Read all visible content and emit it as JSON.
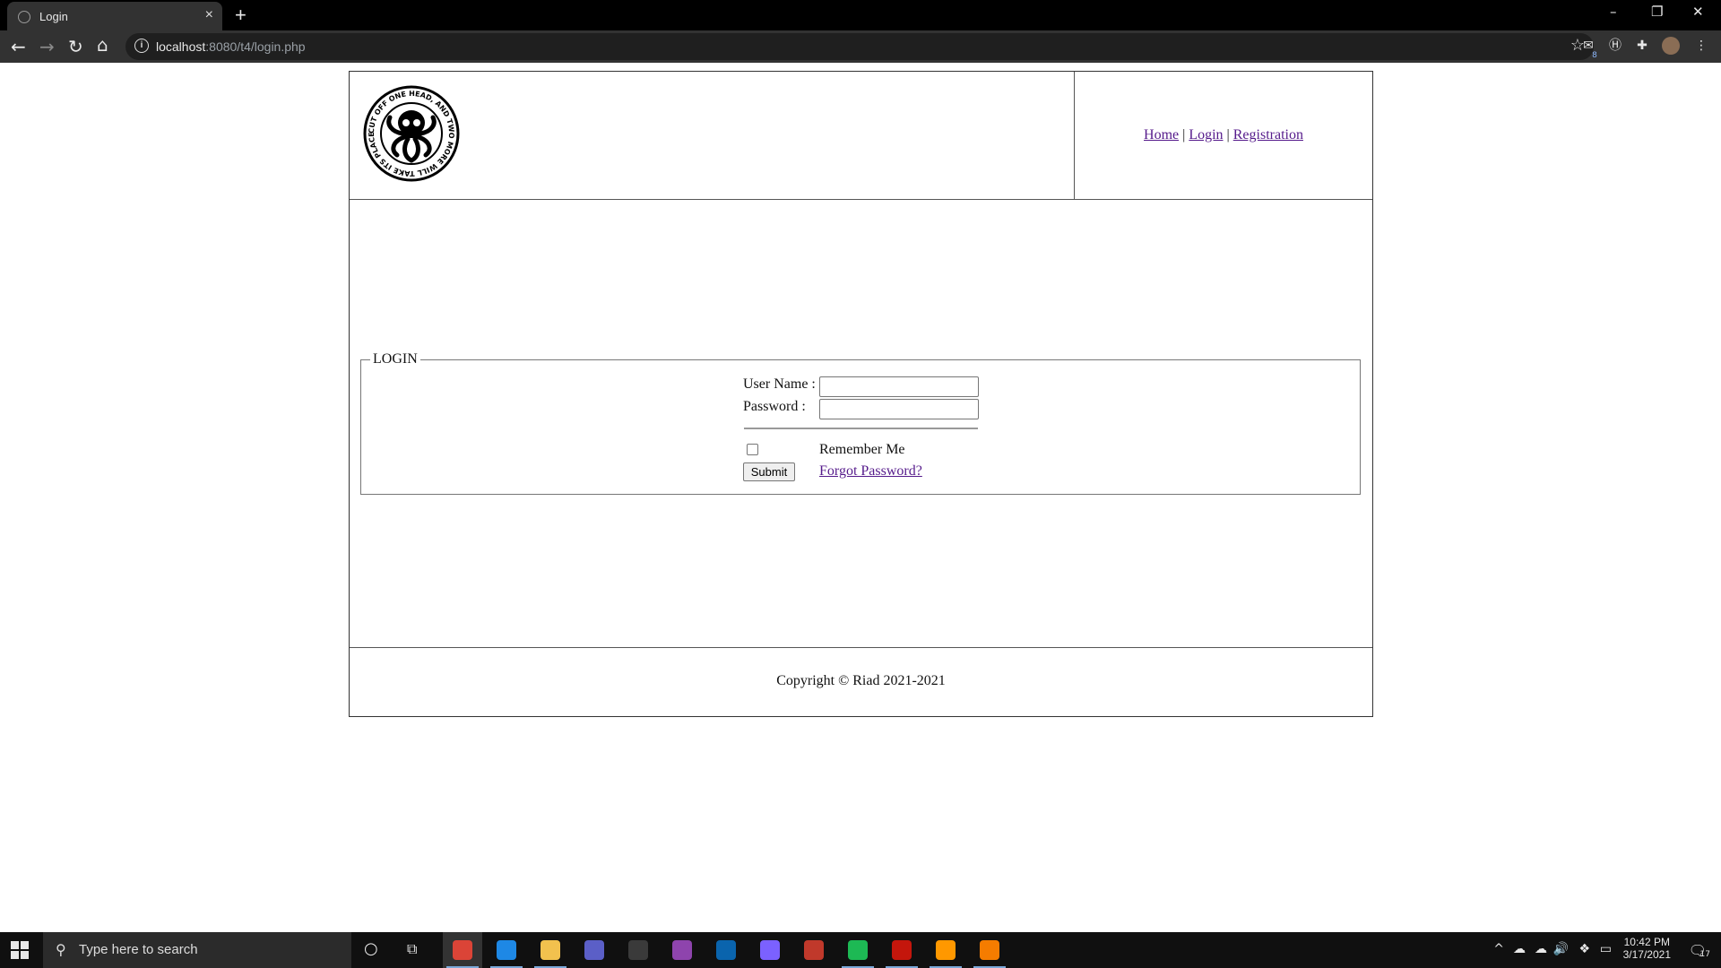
{
  "browser": {
    "tab_title": "Login",
    "tab_close": "×",
    "new_tab": "+",
    "url_host": "localhost",
    "url_rest": ":8080/t4/login.php",
    "info_glyph": "i",
    "window_controls": {
      "minimize": "–",
      "restore": "❐",
      "close": "✕"
    },
    "extension_badge": "8"
  },
  "header": {
    "nav": {
      "home": "Home",
      "sep": " | ",
      "login": "Login",
      "registration": "Registration"
    },
    "logo_text": "CUT OFF ONE HEAD, AND TWO MORE WILL TAKE ITS PLACE"
  },
  "login": {
    "legend": "LOGIN",
    "username_label": "User Name :",
    "password_label": "Password :",
    "username_value": "",
    "password_value": "",
    "remember_label": "Remember Me",
    "remember_checked": false,
    "submit_label": "Submit",
    "forgot_label": "Forgot Password?"
  },
  "footer": {
    "copyright": "Copyright © Riad 2021-2021"
  },
  "taskbar": {
    "search_placeholder": "Type here to search",
    "time": "10:42 PM",
    "date": "3/17/2021",
    "notification_count": "17",
    "apps": [
      {
        "name": "chrome",
        "color": "#db4437",
        "active": true
      },
      {
        "name": "vscode",
        "color": "#1e88e5",
        "active": false
      },
      {
        "name": "file-explorer",
        "color": "#f2c14e",
        "active": false
      },
      {
        "name": "teams",
        "color": "#5b5fc7",
        "active": false
      },
      {
        "name": "obs",
        "color": "#3a3a3a",
        "active": false
      },
      {
        "name": "visual-studio",
        "color": "#8e44ad",
        "active": false
      },
      {
        "name": "outlook",
        "color": "#0a64ad",
        "active": false
      },
      {
        "name": "firefox",
        "color": "#7b61ff",
        "active": false
      },
      {
        "name": "app-paint",
        "color": "#c0392b",
        "active": false
      },
      {
        "name": "spotify",
        "color": "#1db954",
        "active": false
      },
      {
        "name": "acrobat",
        "color": "#c4160c",
        "active": false
      },
      {
        "name": "sublime",
        "color": "#ff9800",
        "active": false
      },
      {
        "name": "blender",
        "color": "#f57c00",
        "active": false
      }
    ]
  }
}
